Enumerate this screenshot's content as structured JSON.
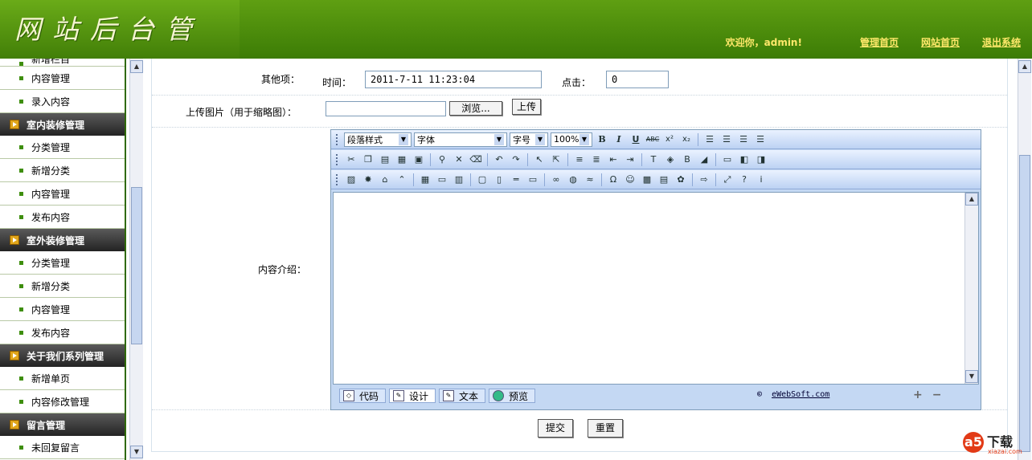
{
  "header": {
    "logo_text": "网站后台管理",
    "welcome": "欢迎你，admin!",
    "links": [
      "管理首页",
      "网站首页",
      "退出系统"
    ]
  },
  "sidebar": {
    "cut_item": "新增栏目",
    "items": [
      {
        "type": "item",
        "label": "内容管理"
      },
      {
        "type": "item",
        "label": "录入内容"
      },
      {
        "type": "cat",
        "label": "室内装修管理"
      },
      {
        "type": "item",
        "label": "分类管理"
      },
      {
        "type": "item",
        "label": "新增分类"
      },
      {
        "type": "item",
        "label": "内容管理"
      },
      {
        "type": "item",
        "label": "发布内容"
      },
      {
        "type": "cat",
        "label": "室外装修管理"
      },
      {
        "type": "item",
        "label": "分类管理"
      },
      {
        "type": "item",
        "label": "新增分类"
      },
      {
        "type": "item",
        "label": "内容管理"
      },
      {
        "type": "item",
        "label": "发布内容"
      },
      {
        "type": "cat",
        "label": "关于我们系列管理"
      },
      {
        "type": "item",
        "label": "新增单页"
      },
      {
        "type": "item",
        "label": "内容修改管理"
      },
      {
        "type": "cat",
        "label": "留言管理"
      },
      {
        "type": "item",
        "label": "未回复留言"
      }
    ]
  },
  "form": {
    "other_label": "其他项：",
    "time_label": "时间：",
    "time_value": "2011-7-11 11:23:04",
    "clicks_label": "点击：",
    "clicks_value": "0",
    "upload_label": "上传图片（用于缩略图）：",
    "browse_button": "浏览...",
    "upload_button": "上传",
    "content_label": "内容介绍：",
    "submit_button": "提交",
    "reset_button": "重置"
  },
  "editor": {
    "format_select": "段落样式",
    "font_select": "字体",
    "size_select": "字号",
    "zoom_select": "100%",
    "tabs": [
      "代码",
      "设计",
      "文本",
      "预览"
    ],
    "active_tab": "设计",
    "credit": "eWebSoft.com",
    "credit_prefix": "©"
  },
  "watermark": {
    "logo": "a5",
    "text": "下载",
    "url": "xiazai.com"
  }
}
